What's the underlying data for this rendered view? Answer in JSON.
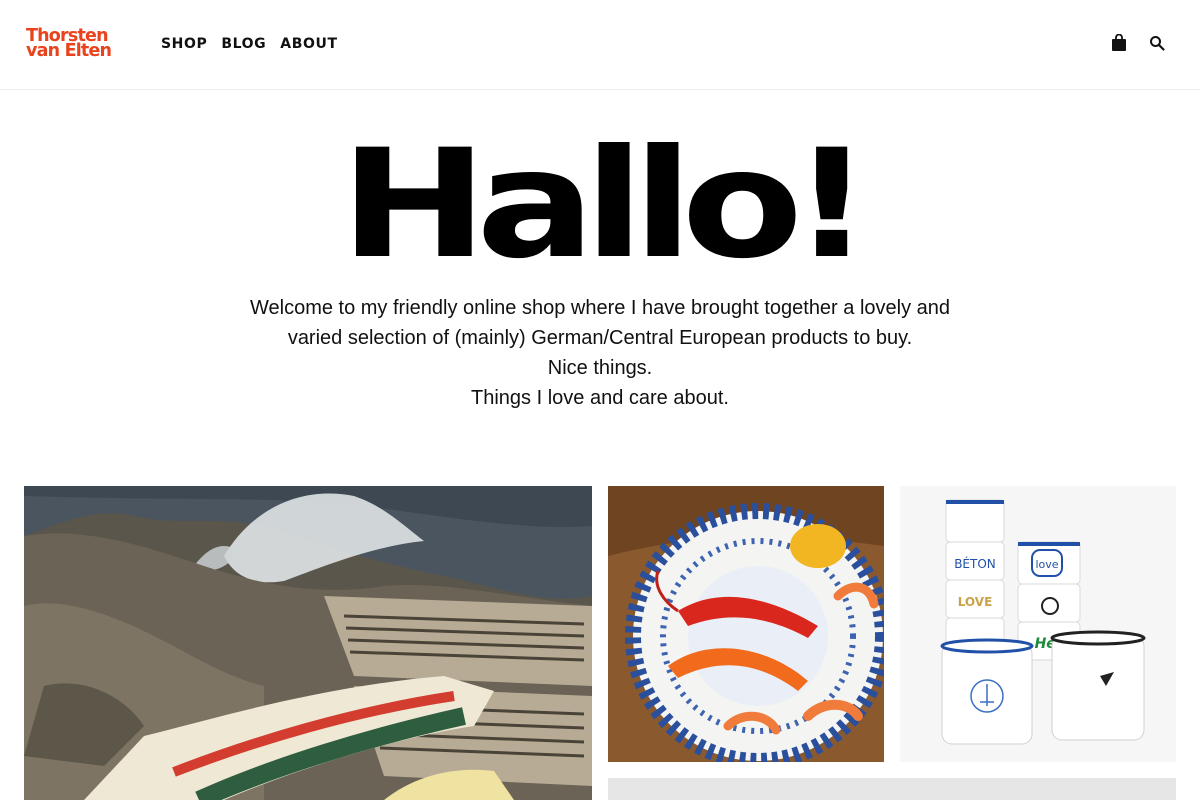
{
  "header": {
    "logo": {
      "line1": "Thorsten",
      "line2": "van Elten"
    },
    "nav": [
      {
        "label": "SHOP"
      },
      {
        "label": "BLOG"
      },
      {
        "label": "ABOUT"
      }
    ],
    "icons": [
      "shopping-bag-icon",
      "search-icon"
    ]
  },
  "hero": {
    "title": "Hallo!",
    "lines": [
      "Welcome to my friendly online shop where I have brought together a lovely and",
      "varied selection of (mainly) German/Central European products to buy.",
      "Nice things.",
      "Things I love and care about."
    ]
  },
  "gallery": {
    "cups": {
      "label1": "BÉTON",
      "label2": "LOVE",
      "label3": "love",
      "label4": "Hell"
    }
  },
  "colors": {
    "brand": "#e8431e",
    "text": "#111111"
  }
}
